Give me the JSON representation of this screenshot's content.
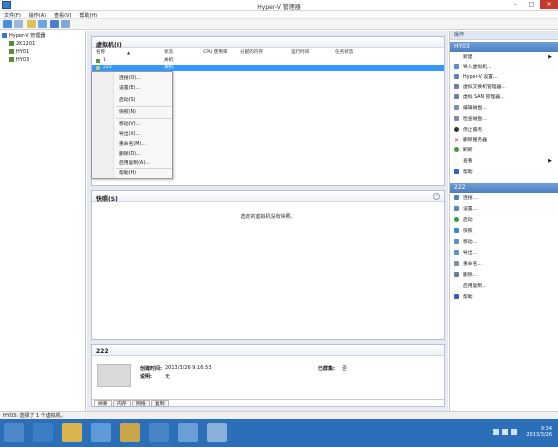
{
  "window": {
    "title": "Hyper-V 管理器"
  },
  "menubar": {
    "items": [
      "文件(F)",
      "操作(A)",
      "查看(V)",
      "帮助(H)"
    ]
  },
  "tree": {
    "root": "Hyper-V 管理器",
    "servers": [
      "2K1201",
      "HY01",
      "HY03"
    ]
  },
  "vm_panel": {
    "title": "虚拟机(I)",
    "columns": [
      "名称",
      "状态",
      "CPU 使用率",
      "分配的内存",
      "运行时间",
      "任务状态"
    ],
    "rows": [
      {
        "name": "1",
        "state": "关机"
      },
      {
        "name": "222",
        "state": "关机"
      }
    ]
  },
  "context_menu": {
    "items": [
      "连接(O)...",
      "设置(E)...",
      "启动(S)",
      "快照(N)",
      "移动(V)...",
      "导出(X)...",
      "重命名(M)...",
      "删除(D)...",
      "启用复制(A)...",
      "帮助(H)"
    ]
  },
  "snapshot_panel": {
    "title": "快照(S)",
    "empty_message": "选定的虚拟机没有快照。"
  },
  "detail_panel": {
    "title": "222",
    "created_label": "创建时间:",
    "created_value": "2013/3/26 9:16:53",
    "notes_label": "说明:",
    "notes_value": "无",
    "clustered_label": "已群集:",
    "clustered_value": "否",
    "tabs": [
      "摘要",
      "内存",
      "网络",
      "复制"
    ]
  },
  "actions": {
    "header": "操作",
    "server_section": "HY03",
    "server_actions": [
      "新建",
      "导入虚拟机...",
      "Hyper-V 设置...",
      "虚拟交换机管理器...",
      "虚拟 SAN 管理器...",
      "编辑磁盘...",
      "检查磁盘...",
      "停止服务",
      "删除服务器",
      "刷新",
      "查看",
      "帮助"
    ],
    "vm_section": "222",
    "vm_actions": [
      "连接...",
      "设置...",
      "启动",
      "快照",
      "移动...",
      "导出...",
      "重命名...",
      "删除...",
      "启用复制...",
      "帮助"
    ]
  },
  "statusbar": {
    "text": "HY03: 选择了 1 个虚拟机。"
  },
  "taskbar": {
    "time": "9:34",
    "date": "2013/3/26"
  },
  "colors": {
    "accent": "#3399ff",
    "section_blue": "#4a7fc0",
    "taskbar": "#2a6fb8",
    "close_red": "#c7382f"
  }
}
